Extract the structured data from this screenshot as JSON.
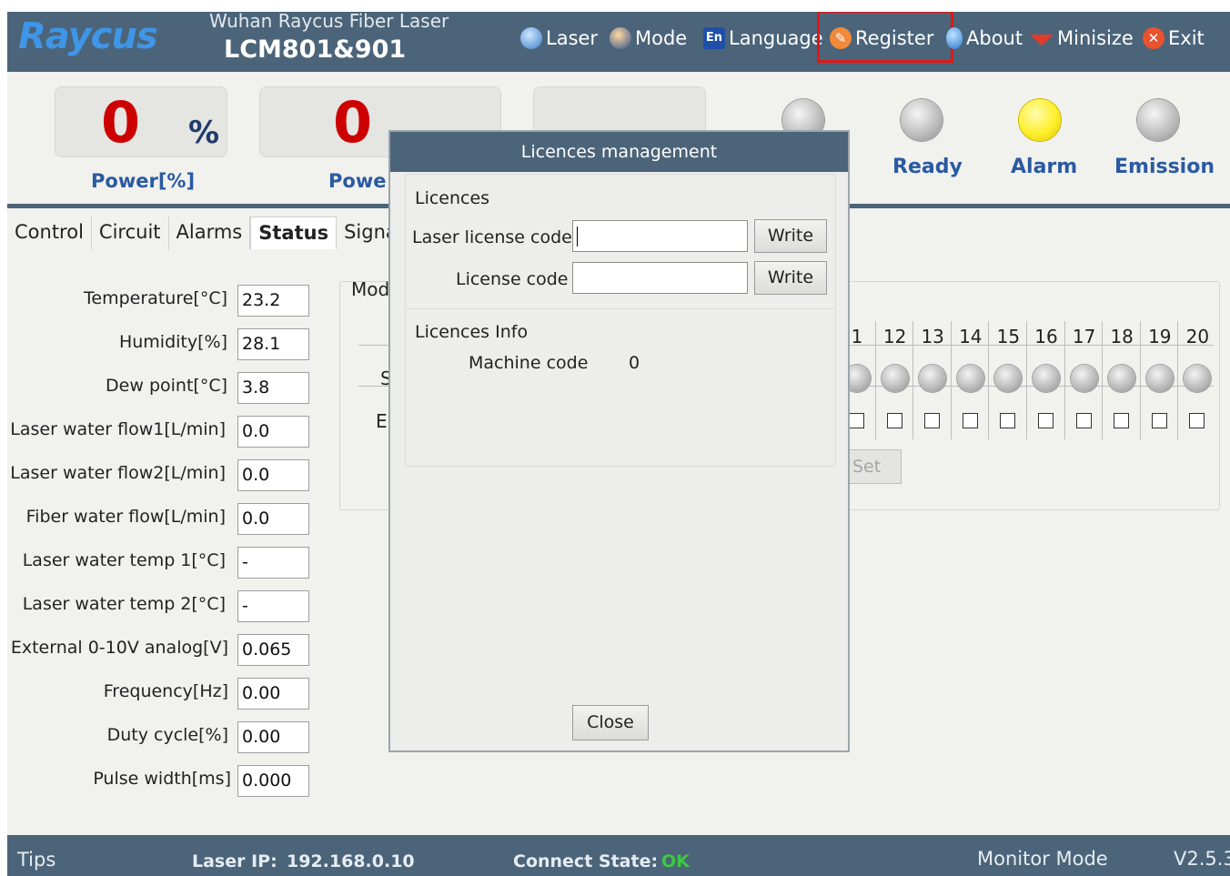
{
  "header": {
    "logo": "Raycus",
    "subtitle": "Wuhan Raycus Fiber Laser",
    "model": "LCM801&901",
    "menu": {
      "laser": "Laser",
      "mode": "Mode",
      "language": "Language",
      "language_icon": "En",
      "register": "Register",
      "about": "About",
      "minimize": "Minisize",
      "exit": "Exit"
    }
  },
  "indicators": {
    "power_pct_value": "0",
    "power_pct_unit": "%",
    "power_pct_label": "Power[%]",
    "power_kw_value": "0",
    "power_kw_label": "Powe",
    "lamps": [
      {
        "label": "Ready",
        "state": "off"
      },
      {
        "label": "Alarm",
        "state": "on",
        "color": "#ffef2a"
      },
      {
        "label": "Emission",
        "state": "off"
      }
    ]
  },
  "tabs": [
    "Control",
    "Circuit",
    "Alarms",
    "Status",
    "Signa"
  ],
  "active_tab": "Status",
  "status": {
    "rows": [
      {
        "label": "Temperature[°C]",
        "value": "23.2"
      },
      {
        "label": "Humidity[%]",
        "value": "28.1"
      },
      {
        "label": "Dew point[°C]",
        "value": "3.8"
      },
      {
        "label": "Laser water flow1[L/min]",
        "value": "0.0"
      },
      {
        "label": "Laser water flow2[L/min]",
        "value": "0.0"
      },
      {
        "label": "Fiber water flow[L/min]",
        "value": "0.0"
      },
      {
        "label": "Laser water temp 1[°C]",
        "value": "-"
      },
      {
        "label": "Laser water temp 2[°C]",
        "value": "-"
      },
      {
        "label": "External 0-10V analog[V]",
        "value": "0.065"
      },
      {
        "label": "Frequency[Hz]",
        "value": "0.00"
      },
      {
        "label": "Duty cycle[%]",
        "value": "0.00"
      },
      {
        "label": "Pulse width[ms]",
        "value": "0.000"
      }
    ],
    "module_title": "Mod",
    "side_s": "S",
    "side_e": "E",
    "module_columns": [
      "1",
      "12",
      "13",
      "14",
      "15",
      "16",
      "17",
      "18",
      "19",
      "20"
    ],
    "set_button": "Set"
  },
  "dialog": {
    "title": "Licences management",
    "section_licences": "Licences",
    "laser_license_label": "Laser license code",
    "laser_license_value": "",
    "license_label": "License code",
    "license_value": "",
    "write_label": "Write",
    "section_info": "Licences Info",
    "machine_code_label": "Machine code",
    "machine_code_value": "0",
    "close_label": "Close"
  },
  "statusbar": {
    "tips": "Tips",
    "ip_label": "Laser IP:",
    "ip_value": "192.168.0.10",
    "connect_label": "Connect State:",
    "connect_value": "OK",
    "connect_color": "#3ec93e",
    "mode": "Monitor Mode",
    "version": "V2.5.3"
  },
  "colors": {
    "title_bar": "#4b6479",
    "highlight": "#e01818",
    "value_red": "#cc0000",
    "label_blue": "#2a5aa0"
  }
}
